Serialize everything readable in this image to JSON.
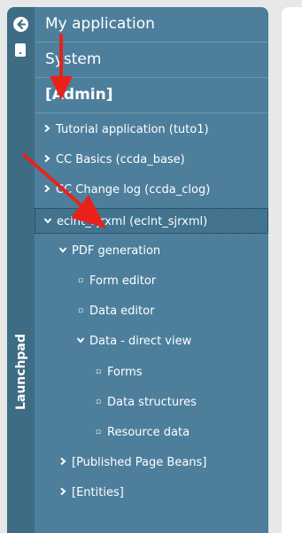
{
  "rail": {
    "label": "Launchpad",
    "back_icon": "arrow-left-icon",
    "doc_icon": "document-icon"
  },
  "headers": {
    "app": "My application",
    "system": "System",
    "admin": "[Admin]"
  },
  "tree": [
    {
      "label": "Tutorial application (tuto1)",
      "level": 0,
      "state": "collapsed"
    },
    {
      "label": "CC Basics (ccda_base)",
      "level": 0,
      "state": "collapsed"
    },
    {
      "label": "CC Change log (ccda_clog)",
      "level": 0,
      "state": "collapsed"
    },
    {
      "label": "eclnt_sjrxml (eclnt_sjrxml)",
      "level": 0,
      "state": "expanded",
      "selected": true
    },
    {
      "label": "PDF generation",
      "level": 1,
      "state": "expanded"
    },
    {
      "label": "Form editor",
      "level": 2,
      "state": "leaf"
    },
    {
      "label": "Data editor",
      "level": 2,
      "state": "leaf"
    },
    {
      "label": "Data - direct view",
      "level": 2,
      "state": "expanded"
    },
    {
      "label": "Forms",
      "level": 3,
      "state": "leaf"
    },
    {
      "label": "Data structures",
      "level": 3,
      "state": "leaf"
    },
    {
      "label": "Resource data",
      "level": 3,
      "state": "leaf"
    },
    {
      "label": "[Published Page Beans]",
      "level": 1,
      "state": "collapsed"
    },
    {
      "label": "[Entities]",
      "level": 1,
      "state": "collapsed"
    }
  ],
  "colors": {
    "panel": "#4d7f9c",
    "rail": "#3d6c84",
    "annotation": "#e8221b"
  }
}
